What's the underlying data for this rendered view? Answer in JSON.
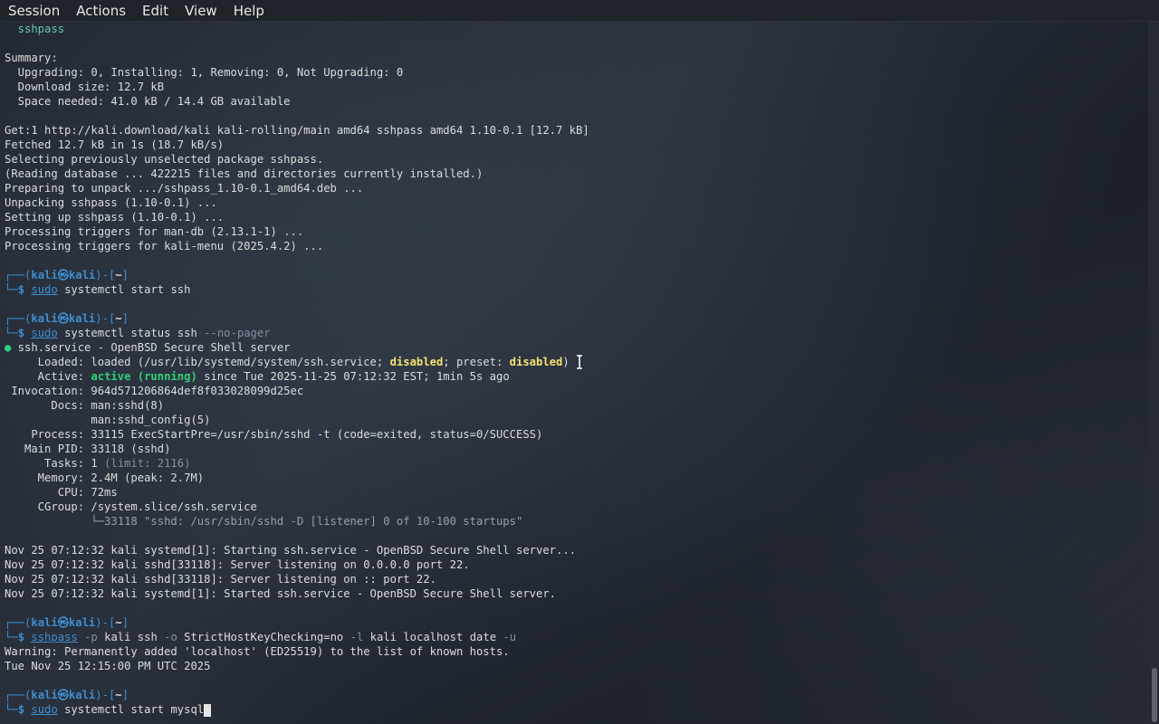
{
  "menu": [
    "Session",
    "Actions",
    "Edit",
    "View",
    "Help"
  ],
  "prompt": {
    "user": "kali",
    "at": "㉿",
    "host": "kali",
    "dir": "~",
    "symbol": "$"
  },
  "lines": [
    "  sshpass",
    "",
    "Summary:",
    "  Upgrading: 0, Installing: 1, Removing: 0, Not Upgrading: 0",
    "  Download size: 12.7 kB",
    "  Space needed: 41.0 kB / 14.4 GB available",
    "",
    "Get:1 http://kali.download/kali kali-rolling/main amd64 sshpass amd64 1.10-0.1 [12.7 kB]",
    "Fetched 12.7 kB in 1s (18.7 kB/s)",
    "Selecting previously unselected package sshpass.",
    "(Reading database ... 422215 files and directories currently installed.)",
    "Preparing to unpack .../sshpass_1.10-0.1_amd64.deb ...",
    "Unpacking sshpass (1.10-0.1) ...",
    "Setting up sshpass (1.10-0.1) ...",
    "Processing triggers for man-db (2.13.1-1) ...",
    "Processing triggers for kali-menu (2025.4.2) ...",
    "",
    "PROMPT",
    "CMD1",
    "",
    "PROMPT",
    "CMD2",
    "● ssh.service - OpenBSD Secure Shell server",
    "LOADED",
    "ACTIVE",
    " Invocation: 964d571206864def8f033028099d25ec",
    "       Docs: man:sshd(8)",
    "             man:sshd_config(5)",
    "    Process: 33115 ExecStartPre=/usr/sbin/sshd -t (code=exited, status=0/SUCCESS)",
    "   Main PID: 33118 (sshd)",
    "TASKS",
    "     Memory: 2.4M (peak: 2.7M)",
    "        CPU: 72ms",
    "     CGroup: /system.slice/ssh.service",
    "CGROUPSUB",
    "",
    "Nov 25 07:12:32 kali systemd[1]: Starting ssh.service - OpenBSD Secure Shell server...",
    "Nov 25 07:12:32 kali sshd[33118]: Server listening on 0.0.0.0 port 22.",
    "Nov 25 07:12:32 kali sshd[33118]: Server listening on :: port 22.",
    "Nov 25 07:12:32 kali systemd[1]: Started ssh.service - OpenBSD Secure Shell server.",
    "",
    "PROMPT",
    "CMD3",
    "Warning: Permanently added 'localhost' (ED25519) to the list of known hosts.",
    "Tue Nov 25 12:15:00 PM UTC 2025",
    "",
    "PROMPT",
    "CMD4"
  ],
  "commands": {
    "cmd1": [
      "sudo",
      " systemctl",
      " start ssh"
    ],
    "cmd2": [
      "sudo",
      " systemctl",
      " status ssh ",
      "--no-pager"
    ],
    "cmd3": [
      "sshpass",
      " -p",
      " kali ssh ",
      "-o",
      " StrictHostKeyChecking=no ",
      "-l",
      " kali localhost date ",
      "-u"
    ],
    "cmd4": [
      "sudo",
      " systemctl",
      " start mysql"
    ]
  },
  "status": {
    "loaded_prefix": "     Loaded: loaded (/usr/lib/systemd/system/ssh.service; ",
    "loaded_disabled1": "disabled",
    "loaded_mid": "; preset: ",
    "loaded_disabled2": "disabled",
    "loaded_suffix": ")",
    "active_prefix": "     Active: ",
    "active_state": "active (running)",
    "active_suffix": " since Tue 2025-11-25 07:12:32 EST; 1min 5s ago",
    "tasks_prefix": "      Tasks: 1 ",
    "tasks_limit": "(limit: 2116)",
    "cgroup_sub": "             └─33118 \"sshd: /usr/sbin/sshd -D [listener] 0 of 10-100 startups\""
  },
  "scrollbar": {
    "position": 0.95
  }
}
